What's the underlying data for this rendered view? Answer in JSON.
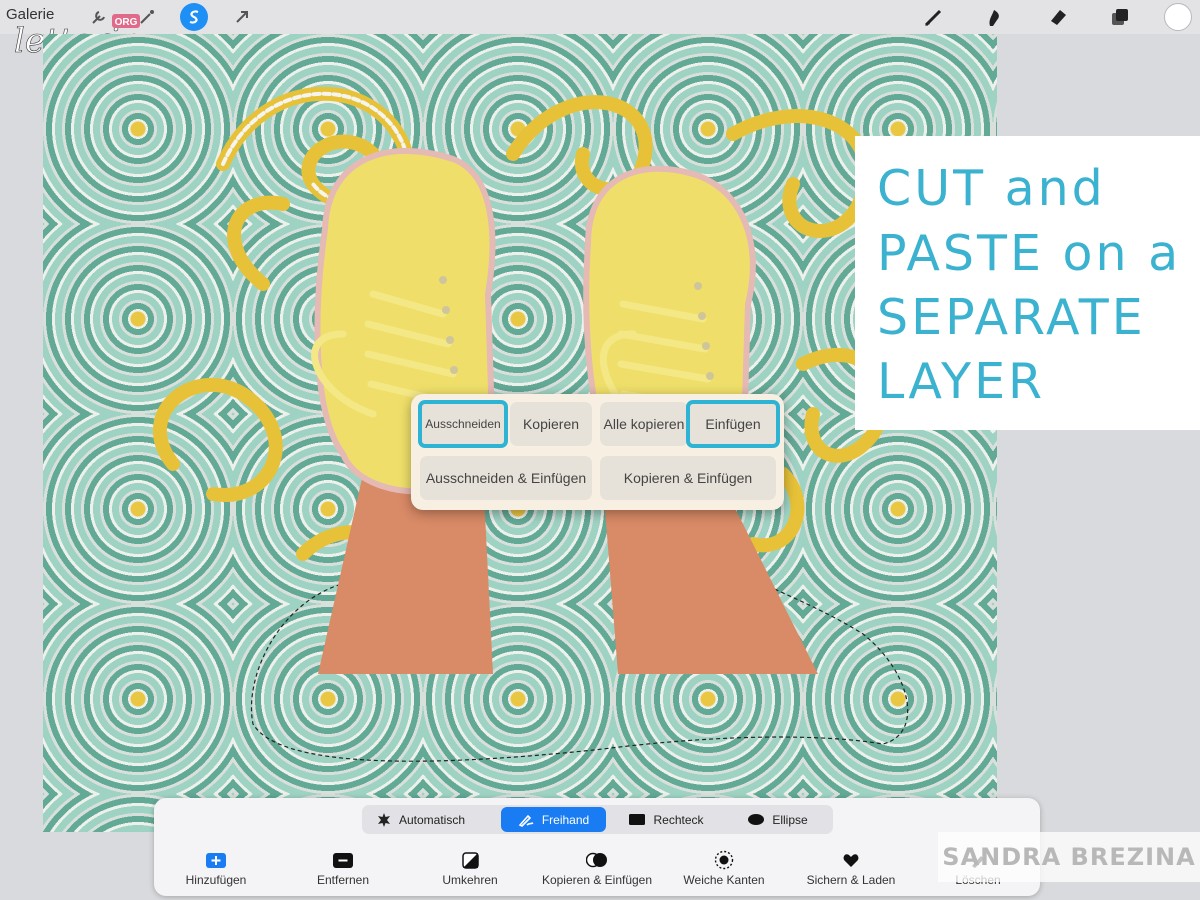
{
  "topbar": {
    "galerie": "Galerie",
    "tools_left": [
      "wrench-icon",
      "magic-wand-icon",
      "selection-icon",
      "move-arrow-icon"
    ],
    "tools_right": [
      "brush-icon",
      "smudge-icon",
      "eraser-icon",
      "layers-icon"
    ],
    "active_color": "#ffffff"
  },
  "watermark": {
    "script": "lettering",
    "badge": "ORG"
  },
  "callout": {
    "lines": [
      "CUT and",
      "PASTE on a",
      "SEPARATE",
      "LAYER"
    ],
    "color": "#3bb2cf"
  },
  "popup": {
    "row1": [
      "Ausschneiden",
      "Kopieren",
      "Alle kopieren",
      "Einfügen"
    ],
    "row2": [
      "Ausschneiden & Einfügen",
      "Kopieren & Einfügen"
    ],
    "highlight_color": "#2fb3d4"
  },
  "selection_modes": {
    "items": [
      "Automatisch",
      "Freihand",
      "Rechteck",
      "Ellipse"
    ],
    "active": "Freihand"
  },
  "tools": [
    "Hinzufügen",
    "Entfernen",
    "Umkehren",
    "Kopieren & Einfügen",
    "Weiche Kanten",
    "Sichern & Laden",
    "Löschen"
  ],
  "credit": "SANDRA BREZINA",
  "colors": {
    "accent": "#1a7cf3",
    "shoe": "#efdf6a",
    "leg": "#d98a66"
  }
}
